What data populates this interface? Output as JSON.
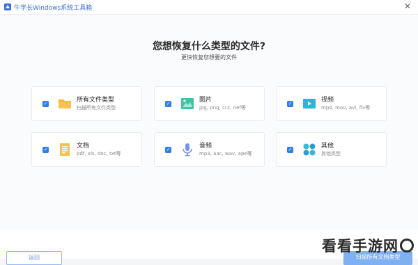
{
  "window": {
    "title": "牛学长Windows系统工具箱",
    "close_icon": "close-icon"
  },
  "main": {
    "heading": "您想恢复什么类型的文件?",
    "subheading": "更快恢复您想要的文件"
  },
  "file_types": [
    {
      "label": "所有文件类型",
      "desc": "扫描所有文件类型",
      "icon": "folder-icon",
      "checked": true,
      "color": "#f7b531"
    },
    {
      "label": "图片",
      "desc": "jpg, png, cr2, nef等",
      "icon": "image-icon",
      "checked": true,
      "color": "#3cc6a4"
    },
    {
      "label": "视频",
      "desc": "mp4, mov, avi, flv等",
      "icon": "video-icon",
      "checked": true,
      "color": "#2bb5d8"
    },
    {
      "label": "文档",
      "desc": "pdf, xls, doc, txt等",
      "icon": "document-icon",
      "checked": true,
      "color": "#f5c24a"
    },
    {
      "label": "音频",
      "desc": "mp3, aac, wav, ape等",
      "icon": "microphone-icon",
      "checked": true,
      "color": "#7d8ff0"
    },
    {
      "label": "其他",
      "desc": "其他类型",
      "icon": "other-icon",
      "checked": true,
      "color": "#36b8d4"
    }
  ],
  "footer": {
    "back_label": "返回",
    "scan_label": "扫描所有文档类型"
  },
  "watermark": {
    "text": "看看手游网"
  },
  "colors": {
    "accent": "#2f7fe6",
    "title_blue": "#3a6fd8"
  }
}
